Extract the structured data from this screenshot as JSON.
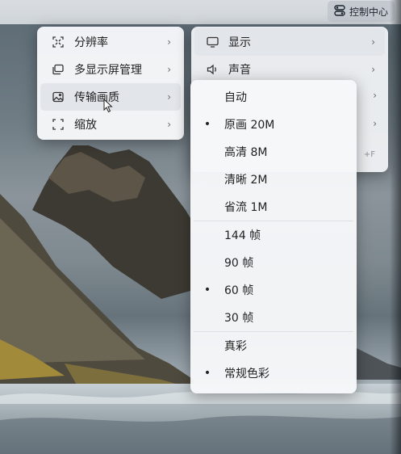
{
  "topbar": {
    "control_center_label": "控制中心",
    "control_center_icon": "toggle-switch-icon"
  },
  "main_menu": {
    "items": [
      {
        "label": "分辨率",
        "icon": "resolution-icon",
        "has_submenu": true
      },
      {
        "label": "多显示屏管理",
        "icon": "multi-display-icon",
        "has_submenu": true
      },
      {
        "label": "传输画质",
        "icon": "image-quality-icon",
        "has_submenu": true,
        "highlighted": true
      },
      {
        "label": "缩放",
        "icon": "zoom-icon",
        "has_submenu": true
      }
    ]
  },
  "display_menu": {
    "items": [
      {
        "label": "显示",
        "icon": "monitor-icon",
        "has_submenu": true,
        "highlighted": true
      },
      {
        "label": "声音",
        "icon": "speaker-icon",
        "has_submenu": true
      }
    ],
    "partial_shortcut": "+F"
  },
  "quality_menu": {
    "groups": [
      {
        "items": [
          {
            "label": "自动",
            "selected": false
          },
          {
            "label": "原画 20M",
            "selected": true
          },
          {
            "label": "高清 8M",
            "selected": false
          },
          {
            "label": "清晰 2M",
            "selected": false
          },
          {
            "label": "省流 1M",
            "selected": false
          }
        ]
      },
      {
        "items": [
          {
            "label": "144 帧",
            "selected": false
          },
          {
            "label": "90 帧",
            "selected": false
          },
          {
            "label": "60 帧",
            "selected": true
          },
          {
            "label": "30 帧",
            "selected": false
          }
        ]
      },
      {
        "items": [
          {
            "label": "真彩",
            "selected": false
          },
          {
            "label": "常规色彩",
            "selected": true
          }
        ]
      }
    ]
  },
  "colors": {
    "menu_bg": "#f6f7f9",
    "highlight_bg": "#e2e5ea",
    "text": "#222222"
  }
}
